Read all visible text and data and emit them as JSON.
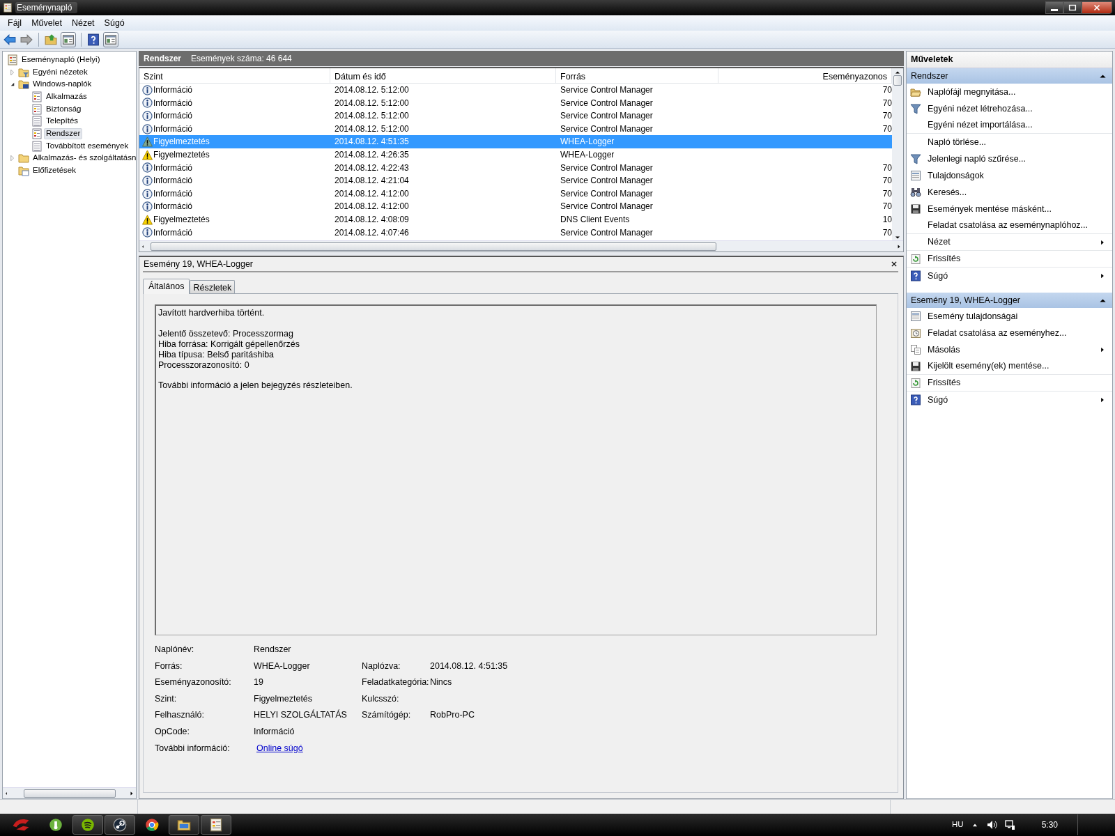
{
  "window": {
    "title": "Eseménynapló"
  },
  "menu": [
    {
      "label": "Fájl"
    },
    {
      "label": "Művelet"
    },
    {
      "label": "Nézet"
    },
    {
      "label": "Súgó"
    }
  ],
  "tree": [
    {
      "label": "Eseménynapló (Helyi)",
      "kind": "viewer",
      "selected": false,
      "children": [
        {
          "label": "Egyéni nézetek",
          "kind": "filter-folder",
          "expanded": false,
          "selected": false
        },
        {
          "label": "Windows-naplók",
          "kind": "pc-folder",
          "expanded": true,
          "selected": false,
          "children": [
            {
              "label": "Alkalmazás",
              "kind": "log",
              "selected": false
            },
            {
              "label": "Biztonság",
              "kind": "log",
              "selected": false
            },
            {
              "label": "Telepítés",
              "kind": "plain-log",
              "selected": false
            },
            {
              "label": "Rendszer",
              "kind": "log",
              "selected": true
            },
            {
              "label": "Továbbított események",
              "kind": "plain-log",
              "selected": false
            }
          ]
        },
        {
          "label": "Alkalmazás- és szolgáltatásn",
          "kind": "folder",
          "expanded": false,
          "selected": false
        },
        {
          "label": "Előfizetések",
          "kind": "subs-folder",
          "selected": false
        }
      ]
    }
  ],
  "log_header": {
    "title": "Rendszer",
    "count": "Események száma: 46 644"
  },
  "events": {
    "columns": [
      "Szint",
      "Dátum és idő",
      "Forrás",
      "Eseményazonos"
    ],
    "rows": [
      {
        "kind": "info",
        "level": "Információ",
        "date": "2014.08.12. 5:12:00",
        "source": "Service Control Manager",
        "id": "70",
        "selected": false
      },
      {
        "kind": "info",
        "level": "Információ",
        "date": "2014.08.12. 5:12:00",
        "source": "Service Control Manager",
        "id": "70",
        "selected": false
      },
      {
        "kind": "info",
        "level": "Információ",
        "date": "2014.08.12. 5:12:00",
        "source": "Service Control Manager",
        "id": "70",
        "selected": false
      },
      {
        "kind": "info",
        "level": "Információ",
        "date": "2014.08.12. 5:12:00",
        "source": "Service Control Manager",
        "id": "70",
        "selected": false
      },
      {
        "kind": "warning",
        "level": "Figyelmeztetés",
        "date": "2014.08.12. 4:51:35",
        "source": "WHEA-Logger",
        "selected": true
      },
      {
        "kind": "warning",
        "level": "Figyelmeztetés",
        "date": "2014.08.12. 4:26:35",
        "source": "WHEA-Logger",
        "selected": false
      },
      {
        "kind": "info",
        "level": "Információ",
        "date": "2014.08.12. 4:22:43",
        "source": "Service Control Manager",
        "id": "70",
        "selected": false
      },
      {
        "kind": "info",
        "level": "Információ",
        "date": "2014.08.12. 4:21:04",
        "source": "Service Control Manager",
        "id": "70",
        "selected": false
      },
      {
        "kind": "info",
        "level": "Információ",
        "date": "2014.08.12. 4:12:00",
        "source": "Service Control Manager",
        "id": "70",
        "selected": false
      },
      {
        "kind": "info",
        "level": "Információ",
        "date": "2014.08.12. 4:12:00",
        "source": "Service Control Manager",
        "id": "70",
        "selected": false
      },
      {
        "kind": "warning",
        "level": "Figyelmeztetés",
        "date": "2014.08.12. 4:08:09",
        "source": "DNS Client Events",
        "id": "10",
        "selected": false
      },
      {
        "kind": "info",
        "level": "Információ",
        "date": "2014.08.12. 4:07:46",
        "source": "Service Control Manager",
        "id": "70",
        "selected": false
      }
    ]
  },
  "details": {
    "title": "Esemény 19, WHEA-Logger",
    "tabs": [
      {
        "label": "Általános",
        "selected": true
      },
      {
        "label": "Részletek",
        "selected": false
      }
    ],
    "message": [
      [
        "Javított hardverhiba történt."
      ],
      [
        "Jelentő összetevő: Processzormag",
        "Hiba forrása: Korrigált gépellenőrzés",
        "Hiba típusa: Belső paritáshiba",
        "Processzorazonosító: 0"
      ],
      [
        "További információ a jelen bejegyzés részleteiben."
      ]
    ],
    "properties": [
      {
        "kind": "text",
        "label": "Naplónév:",
        "value": "Rendszer"
      },
      {
        "kind": "text",
        "label": "Forrás:",
        "value": "WHEA-Logger",
        "label_2": "Naplózva:",
        "value_2": "2014.08.12. 4:51:35"
      },
      {
        "kind": "text",
        "label": "Eseményazonosító:",
        "value": "19",
        "label_2": "Feladatkategória:",
        "value_2": "Nincs"
      },
      {
        "kind": "text",
        "label": "Szint:",
        "value": "Figyelmeztetés",
        "label_2": "Kulcsszó:"
      },
      {
        "kind": "text",
        "label": "Felhasználó:",
        "value": "HELYI SZOLGÁLTATÁS",
        "label_2": "Számítógép:",
        "value_2": "RobPro-PC"
      },
      {
        "kind": "text",
        "label": "OpCode:",
        "value": "Információ"
      },
      {
        "kind": "link",
        "label": "További információ:",
        "value": "Online súgó"
      }
    ]
  },
  "actions": {
    "title": "Műveletek",
    "sections": [
      {
        "title": "Rendszer",
        "expanded": true,
        "items": [
          {
            "label": "Naplófájl megnyitása...",
            "kind": "open-folder",
            "submenu": false,
            "group_end": false
          },
          {
            "label": "Egyéni nézet létrehozása...",
            "kind": "filter",
            "submenu": false,
            "group_end": false
          },
          {
            "label": "Egyéni nézet importálása...",
            "kind": "none",
            "submenu": false,
            "group_end": true
          },
          {
            "label": "Napló törlése...",
            "kind": "none",
            "submenu": false,
            "group_end": false
          },
          {
            "label": "Jelenlegi napló szűrése...",
            "kind": "filter",
            "submenu": false,
            "group_end": false
          },
          {
            "label": "Tulajdonságok",
            "kind": "properties",
            "submenu": false,
            "group_end": false
          },
          {
            "label": "Keresés...",
            "kind": "binoculars",
            "submenu": false,
            "group_end": false
          },
          {
            "label": "Események mentése másként...",
            "kind": "save",
            "submenu": false,
            "group_end": false
          },
          {
            "label": "Feladat csatolása az eseménynaplóhoz...",
            "kind": "none",
            "submenu": false,
            "group_end": true
          },
          {
            "label": "Nézet",
            "kind": "none",
            "submenu": true,
            "group_end": true
          },
          {
            "label": "Frissítés",
            "kind": "refresh",
            "submenu": false,
            "group_end": true
          },
          {
            "label": "Súgó",
            "kind": "help",
            "submenu": true,
            "group_end": false
          }
        ]
      },
      {
        "title": "Esemény 19, WHEA-Logger",
        "expanded": true,
        "items": [
          {
            "label": "Esemény tulajdonságai",
            "kind": "properties",
            "submenu": false,
            "group_end": false
          },
          {
            "label": "Feladat csatolása az eseményhez...",
            "kind": "task",
            "submenu": false,
            "group_end": false
          },
          {
            "label": "Másolás",
            "kind": "copy",
            "submenu": true,
            "group_end": false
          },
          {
            "label": "Kijelölt esemény(ek) mentése...",
            "kind": "save",
            "submenu": false,
            "group_end": true
          },
          {
            "label": "Frissítés",
            "kind": "refresh",
            "submenu": false,
            "group_end": true
          },
          {
            "label": "Súgó",
            "kind": "help",
            "submenu": true,
            "group_end": false
          }
        ]
      }
    ]
  },
  "taskbar": {
    "apps": [
      {
        "kind": "torrent",
        "open": false
      },
      {
        "kind": "spotify",
        "open": true
      },
      {
        "kind": "steam",
        "open": true
      },
      {
        "kind": "chrome",
        "open": false
      },
      {
        "kind": "folder",
        "open": true
      },
      {
        "kind": "viewer",
        "open": true
      }
    ],
    "language": "HU",
    "clock": "5:30"
  }
}
